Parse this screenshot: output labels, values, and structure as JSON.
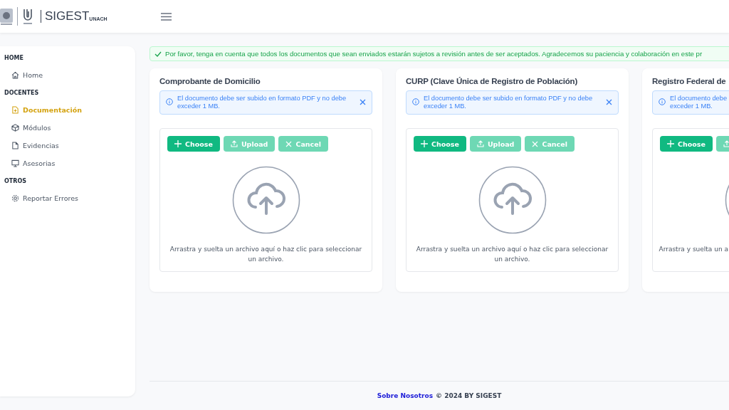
{
  "header": {
    "brand": "SIGEST",
    "brand_sub": "UNACH"
  },
  "sidebar": {
    "sections": [
      {
        "title": "HOME",
        "items": [
          {
            "label": "Home",
            "selected": false
          }
        ]
      },
      {
        "title": "DOCENTES",
        "items": [
          {
            "label": "Documentación",
            "selected": true
          },
          {
            "label": "Módulos",
            "selected": false
          },
          {
            "label": "Evidencias",
            "selected": false
          },
          {
            "label": "Asesorias",
            "selected": false
          }
        ]
      },
      {
        "title": "OTROS",
        "items": [
          {
            "label": "Reportar Errores",
            "selected": false
          }
        ]
      }
    ]
  },
  "notice": "Por favor, tenga en cuenta que todos los documentos que sean enviados estarán sujetos a revisión antes de ser aceptados. Agradecemos su paciencia y colaboración en este pr",
  "cards": [
    {
      "title": "Comprobante de Domicilio",
      "info": "El documento debe ser subido en formato PDF y no debe exceder 1 MB.",
      "buttons": [
        {
          "kind": "choose",
          "label": "Choose",
          "disabled": false
        },
        {
          "kind": "upload",
          "label": "Upload",
          "disabled": true
        },
        {
          "kind": "cancel",
          "label": "Cancel",
          "disabled": true
        }
      ],
      "drop_text": "Arrastra y suelta un archivo aquí o haz clic para seleccionar un archivo."
    },
    {
      "title": "CURP (Clave Única de Registro de Población)",
      "info": "El documento debe ser subido en formato PDF y no debe exceder 1 MB.",
      "buttons": [
        {
          "kind": "choose",
          "label": "Choose",
          "disabled": false
        },
        {
          "kind": "upload",
          "label": "Upload",
          "disabled": true
        },
        {
          "kind": "cancel",
          "label": "Cancel",
          "disabled": true
        }
      ],
      "drop_text": "Arrastra y suelta un archivo aquí o haz clic para seleccionar un archivo."
    },
    {
      "title": "Registro Federal de",
      "info": "El documento debe exceder 1 MB.",
      "buttons": [
        {
          "kind": "choose",
          "label": "Choose",
          "disabled": false
        },
        {
          "kind": "upload",
          "disabled": true
        }
      ],
      "drop_text": "Arrastra y suelta un a"
    }
  ],
  "footer": {
    "link": "Sobre Nosotros",
    "text": "© 2024 BY SIGEST"
  }
}
